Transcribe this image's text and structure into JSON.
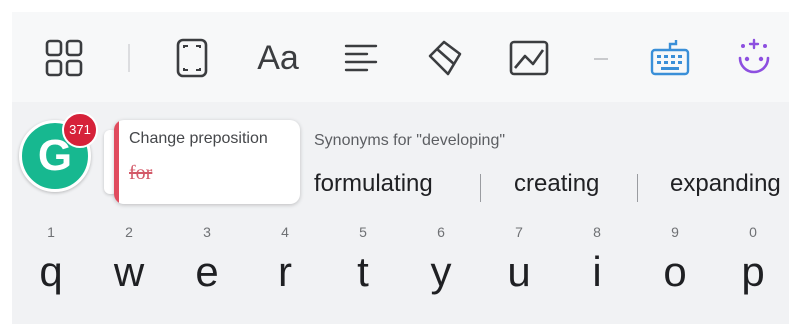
{
  "toolbar": {
    "icons": [
      "apps-grid-icon",
      "fullscreen-icon",
      "font-icon",
      "align-left-icon",
      "eraser-icon",
      "image-icon",
      "keyboard-icon",
      "face-sparkle-icon"
    ],
    "font_glyph": "Aa"
  },
  "grammarly": {
    "logo_letter": "G",
    "badge_count": "371",
    "card_title": "Change preposition",
    "card_strike": "for"
  },
  "synonyms": {
    "heading": "Synonyms for \"developing\"",
    "items": [
      "formulating",
      "creating",
      "expanding"
    ]
  },
  "keyboard": {
    "row1": [
      {
        "num": "1",
        "ch": "q"
      },
      {
        "num": "2",
        "ch": "w"
      },
      {
        "num": "3",
        "ch": "e"
      },
      {
        "num": "4",
        "ch": "r"
      },
      {
        "num": "5",
        "ch": "t"
      },
      {
        "num": "6",
        "ch": "y"
      },
      {
        "num": "7",
        "ch": "u"
      },
      {
        "num": "8",
        "ch": "i"
      },
      {
        "num": "9",
        "ch": "o"
      },
      {
        "num": "0",
        "ch": "p"
      }
    ]
  },
  "colors": {
    "grammarly_green": "#17b890",
    "badge_red": "#d6223a",
    "accent_blue": "#3a8fd8",
    "accent_purple": "#8d4fe0"
  }
}
